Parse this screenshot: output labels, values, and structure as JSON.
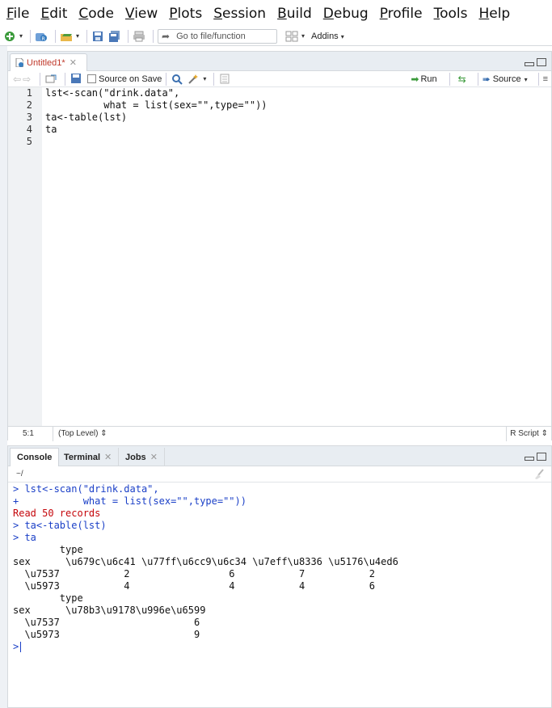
{
  "menu": [
    "File",
    "Edit",
    "Code",
    "View",
    "Plots",
    "Session",
    "Build",
    "Debug",
    "Profile",
    "Tools",
    "Help"
  ],
  "menu_accel": [
    "F",
    "E",
    "C",
    "V",
    "P",
    "S",
    "B",
    "D",
    "P",
    "T",
    "H"
  ],
  "toolbar": {
    "goto_placeholder": "Go to file/function",
    "addins_label": "Addins"
  },
  "editor": {
    "tab_title": "Untitled1*",
    "source_on_save_label": "Source on Save",
    "run_label": "Run",
    "source_label": "Source",
    "line_numbers": [
      "1",
      "2",
      "3",
      "4",
      "5"
    ],
    "code_lines": [
      "lst<-scan(\"drink.data\",",
      "          what = list(sex=\"\",type=\"\"))",
      "ta<-table(lst)",
      "ta",
      ""
    ],
    "status_position": "5:1",
    "status_level": "(Top Level)",
    "status_filetype": "R Script"
  },
  "console": {
    "tabs": [
      "Console",
      "Terminal",
      "Jobs"
    ],
    "working_dir": "~/",
    "lines": [
      {
        "text": "> lst<-scan(\"drink.data\",",
        "color": "blue"
      },
      {
        "text": "+           what = list(sex=\"\",type=\"\"))",
        "color": "blue"
      },
      {
        "text": "Read 50 records",
        "color": "red"
      },
      {
        "text": "> ta<-table(lst)",
        "color": "blue"
      },
      {
        "text": "> ta",
        "color": "blue"
      },
      {
        "text": "        type",
        "color": "black"
      },
      {
        "text": "sex      \\u679c\\u6c41 \\u77ff\\u6cc9\\u6c34 \\u7eff\\u8336 \\u5176\\u4ed6",
        "color": "black"
      },
      {
        "text": "  \\u7537           2                 6           7           2",
        "color": "black"
      },
      {
        "text": "  \\u5973           4                 4           4           6",
        "color": "black"
      },
      {
        "text": "        type",
        "color": "black"
      },
      {
        "text": "sex      \\u78b3\\u9178\\u996e\\u6599",
        "color": "black"
      },
      {
        "text": "  \\u7537                       6",
        "color": "black"
      },
      {
        "text": "  \\u5973                       9",
        "color": "black"
      }
    ],
    "prompt": ">"
  }
}
